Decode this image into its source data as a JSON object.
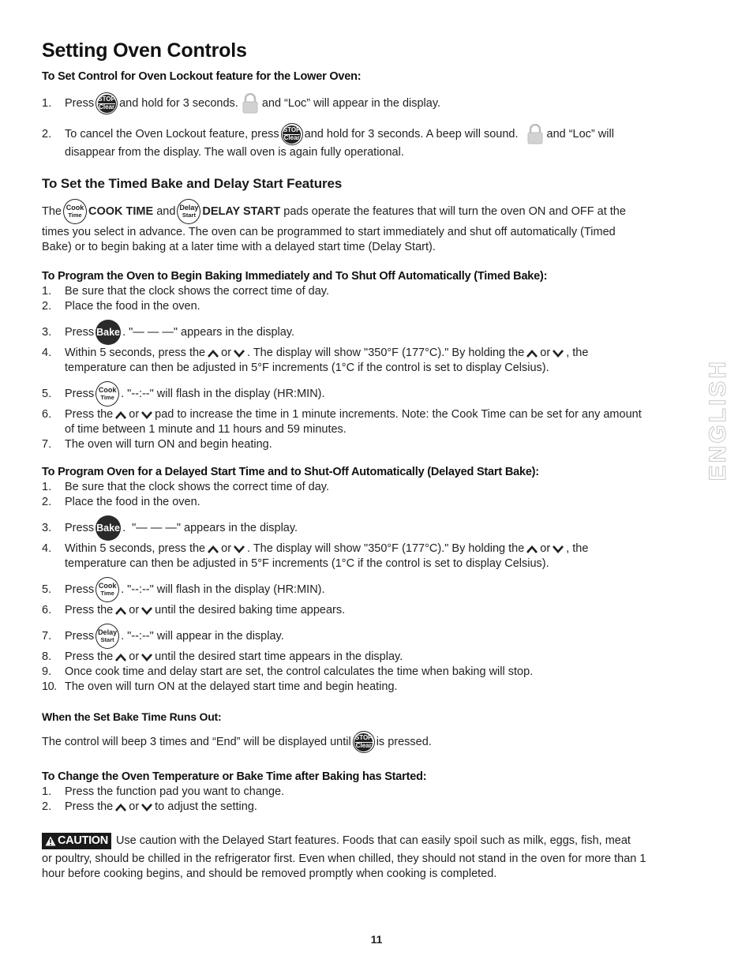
{
  "page": {
    "title": "Setting Oven Controls",
    "page_number": "11",
    "side_tab": "ENGLISH"
  },
  "icons": {
    "stop_clear": {
      "line1": "STOP",
      "line2": "Clear"
    },
    "cook_time": {
      "line1": "Cook",
      "line2": "Time"
    },
    "delay_start": {
      "line1": "Delay",
      "line2": "Start"
    },
    "bake": "Bake",
    "caution_label": "CAUTION",
    "caution_symbol": "!"
  },
  "lockout": {
    "heading": "To Set Control for Oven Lockout feature for the Lower Oven:",
    "steps": [
      {
        "num": "1.",
        "a": "Press",
        "b": "and hold for 3 seconds.",
        "c": "and “Loc” will appear in the display."
      },
      {
        "num": "2.",
        "a": "To cancel the Oven Lockout feature, press",
        "b": "and hold for 3 seconds. A beep will sound.",
        "c": "and “Loc” will",
        "d": "disappear from the display. The wall oven is again fully operational."
      }
    ]
  },
  "timed_delay": {
    "heading": "To Set the Timed Bake and Delay Start Features",
    "intro_the": "The",
    "intro_cook_time": "COOK TIME",
    "intro_and": "and",
    "intro_delay_start": "DELAY START",
    "intro_rest1": "pads operate the features that will turn the oven ON and OFF at the",
    "intro_line2": "times you select in advance. The oven can be programmed to start immediately and shut off automatically (Timed",
    "intro_line3": "Bake) or to begin baking at a later time with a delayed start time (Delay Start)."
  },
  "timed_bake": {
    "heading": "To Program the Oven to Begin Baking Immediately and To Shut Off Automatically (Timed Bake):",
    "s1": {
      "num": "1.",
      "text": "Be sure that the clock shows the correct time of day."
    },
    "s2": {
      "num": "2.",
      "text": "Place the food in the oven."
    },
    "s3": {
      "num": "3.",
      "a": "Press",
      "b": ". \"— — —\" appears in the display."
    },
    "s4": {
      "num": "4.",
      "a": "Within 5 seconds, press the",
      "or": "or",
      "b": ". The display will show \"350°F (177°C).\" By holding the",
      "c": ", the",
      "line2": "temperature can then be adjusted in 5°F increments (1°C if the control is set to display Celsius)."
    },
    "s5": {
      "num": "5.",
      "a": "Press",
      "b": ". \"--:--\" will flash in the display (HR:MIN)."
    },
    "s6": {
      "num": "6.",
      "a": "Press the",
      "or": "or",
      "b": "pad to increase the time in 1 minute increments. Note: the Cook Time can be set for any amount",
      "line2": "of time between 1 minute and 11 hours and 59 minutes."
    },
    "s7": {
      "num": "7.",
      "text": "The oven will turn ON and begin heating."
    }
  },
  "delayed_bake": {
    "heading": "To Program Oven for a Delayed Start Time and to Shut-Off Automatically (Delayed Start Bake):",
    "s1": {
      "num": "1.",
      "text": "Be sure that the clock shows the correct time of day."
    },
    "s2": {
      "num": "2.",
      "text": "Place the food in the oven."
    },
    "s3": {
      "num": "3.",
      "a": "Press",
      "b": ".  \"— — —\" appears in the display."
    },
    "s4": {
      "num": "4.",
      "a": "Within 5 seconds, press the",
      "or": "or",
      "b": ". The display will show \"350°F (177°C).\" By holding the",
      "c": ", the",
      "line2": "temperature can then be adjusted in 5°F increments (1°C if the control is set to display Celsius)."
    },
    "s5": {
      "num": "5.",
      "a": "Press",
      "b": ". \"--:--\" will flash in the display (HR:MIN)."
    },
    "s6": {
      "num": "6.",
      "a": "Press the",
      "or": "or",
      "b": "until the desired baking time appears."
    },
    "s7": {
      "num": "7.",
      "a": "Press",
      "b": ". \"--:--\" will appear in the display."
    },
    "s8": {
      "num": "8.",
      "a": "Press the",
      "or": "or",
      "b": "until the desired start time appears in the display."
    },
    "s9": {
      "num": "9.",
      "text": "Once cook time and delay start are set, the control calculates the time when baking will stop."
    },
    "s10": {
      "num": "10.",
      "text": "The oven will turn ON at the delayed start time and begin heating."
    }
  },
  "runs_out": {
    "heading": "When the Set Bake Time Runs Out:",
    "a": "The control will beep 3 times and “End” will be displayed until",
    "b": "is pressed."
  },
  "change": {
    "heading": "To Change the Oven Temperature or Bake Time after Baking has Started:",
    "s1": {
      "num": "1.",
      "text": "Press the function pad you want to change."
    },
    "s2": {
      "num": "2.",
      "a": "Press the",
      "or": "or",
      "b": "to adjust the setting."
    }
  },
  "caution": {
    "line1": "Use caution with the Delayed Start features. Foods that can easily spoil such as milk, eggs, fish, meat",
    "line2": "or poultry, should be chilled in the refrigerator first. Even when chilled, they should not stand in the oven for more than 1",
    "line3": "hour before cooking begins, and should be removed promptly when cooking is completed."
  }
}
